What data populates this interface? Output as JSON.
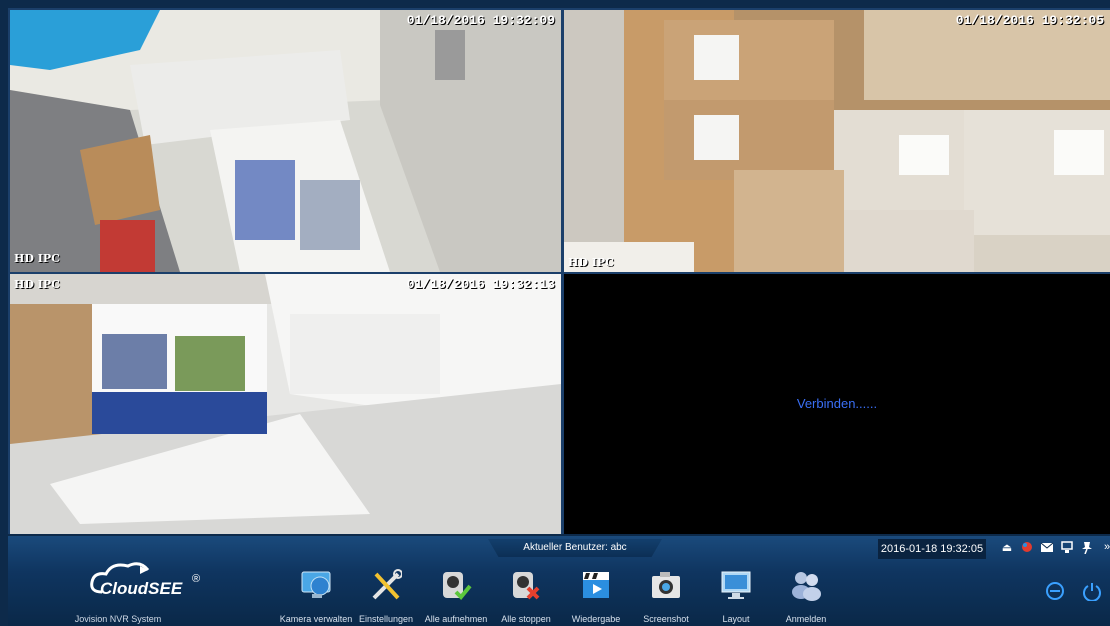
{
  "cameras": [
    {
      "time": "01/18/2016 19:32:09",
      "tag": "HD IPC"
    },
    {
      "time": "01/18/2016 19:32:05",
      "tag": "HD IPC"
    },
    {
      "time": "01/18/2016 19:32:13",
      "tag": "HD IPC"
    },
    {
      "status": "Verbinden......"
    }
  ],
  "statusbar": {
    "current_user": "Aktueller Benutzer: abc",
    "datetime": "2016-01-18 19:32:05"
  },
  "brand": {
    "logo_text": "CloudSEE",
    "registered": "®",
    "app_name": "Jovision NVR System"
  },
  "toolbar": [
    {
      "label": "Kamera verwalten",
      "icon": "monitor-globe-icon"
    },
    {
      "label": "Einstellungen",
      "icon": "tools-icon"
    },
    {
      "label": "Alle aufnehmen",
      "icon": "camera-record-icon"
    },
    {
      "label": "Alle stoppen",
      "icon": "camera-stop-icon"
    },
    {
      "label": "Wiedergabe",
      "icon": "playback-icon"
    },
    {
      "label": "Screenshot",
      "icon": "screenshot-camera-icon"
    },
    {
      "label": "Layout",
      "icon": "layout-monitor-icon"
    },
    {
      "label": "Anmelden",
      "icon": "users-icon"
    }
  ],
  "tray_icons": [
    "eject-icon",
    "alarm-icon",
    "mail-icon",
    "network-icon",
    "pin-icon",
    "expand-icon"
  ],
  "colors": {
    "accent": "#3a6ff5",
    "panel": "#0f3560",
    "border": "#1b3f6a"
  }
}
